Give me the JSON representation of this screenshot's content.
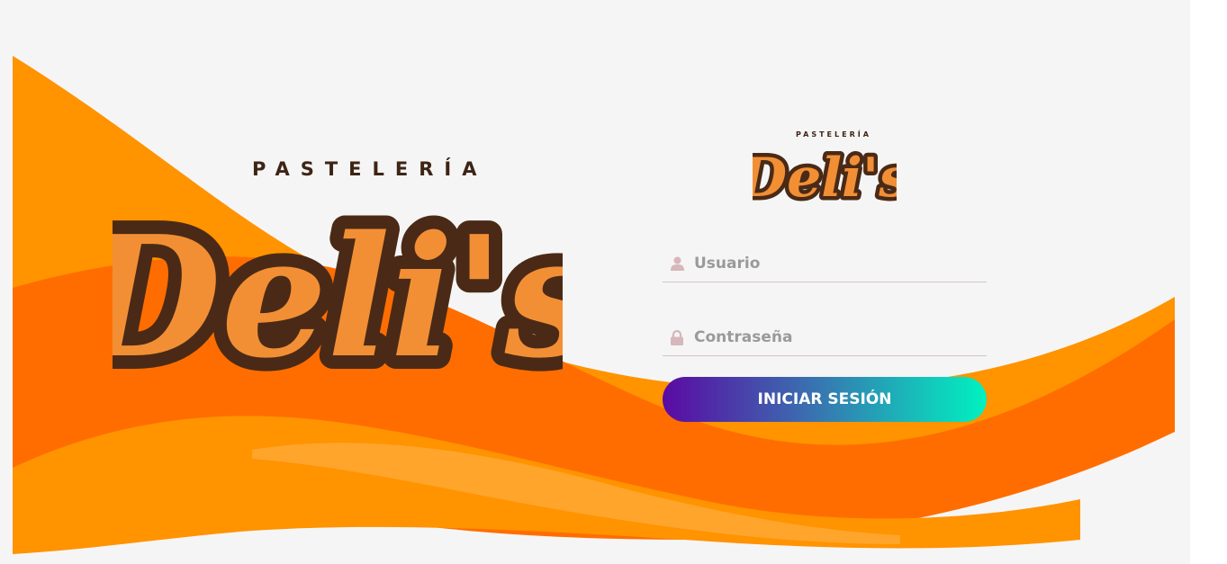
{
  "brand": {
    "subtitle": "PASTELERÍA",
    "name": "Deli's"
  },
  "login_form": {
    "username": {
      "placeholder": "Usuario",
      "value": "",
      "icon": "user-icon"
    },
    "password": {
      "placeholder": "Contraseña",
      "value": "",
      "icon": "lock-icon"
    },
    "submit_label": "INICIAR SESIÓN"
  },
  "colors": {
    "background": "#f5f5f5",
    "wave_dark_orange": "#ff6d00",
    "wave_light_orange": "#ff9300",
    "logo_fill": "#f28f35",
    "logo_outline": "#4a2a16",
    "button_gradient_start": "#5a0aa3",
    "button_gradient_end": "#00f2c0",
    "icon_color": "#d6b7bb"
  }
}
